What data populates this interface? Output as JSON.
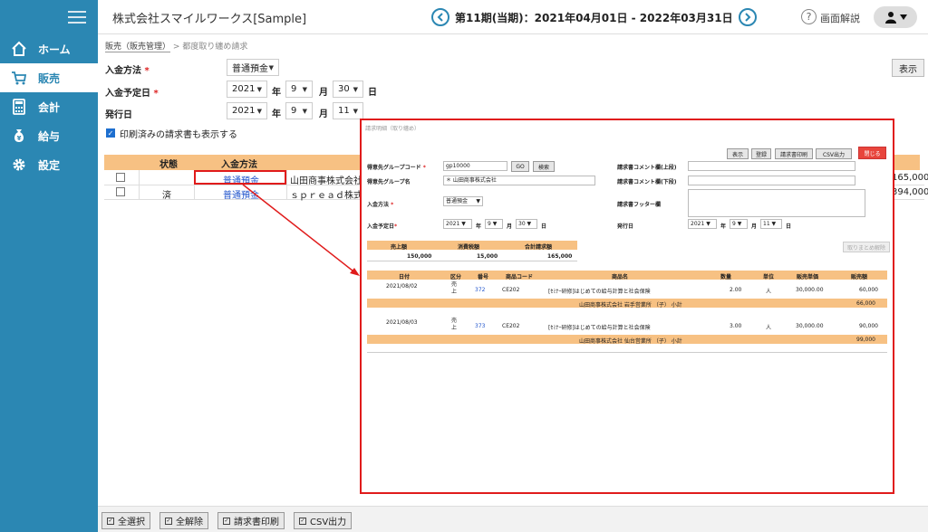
{
  "sidebar": {
    "items": [
      {
        "label": "ホーム",
        "icon": "home-icon"
      },
      {
        "label": "販売",
        "icon": "cart-icon"
      },
      {
        "label": "会計",
        "icon": "calculator-icon"
      },
      {
        "label": "給与",
        "icon": "money-bag-icon"
      },
      {
        "label": "設定",
        "icon": "gear-icon"
      }
    ]
  },
  "header": {
    "company": "株式会社スマイルワークス[Sample]",
    "period": "第11期(当期)：2021年04月01日 - 2022年03月31日",
    "help": "画面解説"
  },
  "breadcrumb": {
    "link": "販売（販売管理）",
    "sep": ">",
    "current": "都度取り纏め請求"
  },
  "form": {
    "payment_method_label": "入金方法",
    "payment_method_value": "普通預金",
    "due_date_label": "入金予定日",
    "due_year": "2021",
    "due_month": "9",
    "due_day": "30",
    "issue_date_label": "発行日",
    "issue_year": "2021",
    "issue_month": "9",
    "issue_day": "11",
    "year_unit": "年",
    "month_unit": "月",
    "day_unit": "日",
    "required": "*",
    "show_printed_label": "印刷済みの請求書も表示する",
    "show_button": "表示"
  },
  "list": {
    "headers": [
      "状態",
      "入金方法"
    ],
    "rows": [
      {
        "status": "",
        "method": "普通預金",
        "customer": "山田商事株式会社",
        "amount": "165,000"
      },
      {
        "status": "済",
        "method": "普通預金",
        "customer": "ｓｐｒｅａｄ株式",
        "amount": "394,000"
      }
    ]
  },
  "bottom": {
    "buttons": [
      "全選択",
      "全解除",
      "請求書印刷",
      "CSV出力"
    ]
  },
  "modal": {
    "title": "請求明細（取り纏め）",
    "buttons": [
      "表示",
      "登録",
      "請求書印刷",
      "CSV出力"
    ],
    "close": "閉じる",
    "group_code_label": "得意先グループコード",
    "group_code_value": "gp10000",
    "go": "GO",
    "search": "検索",
    "group_name_label": "得意先グループ名",
    "group_name_value": "＊ 山田商事株式会社",
    "method_label": "入金方法",
    "method_value": "普通預金",
    "due_label": "入金予定日",
    "due_year": "2021",
    "due_month": "9",
    "due_day": "30",
    "comment_top_label": "請求書コメント欄(上段)",
    "comment_bottom_label": "請求書コメント欄(下段)",
    "footer_label": "請求書フッター欄",
    "issue_label": "発行日",
    "issue_year": "2021",
    "issue_month": "9",
    "issue_day": "11",
    "summary_headers": [
      "売上額",
      "消費税額",
      "合計請求額"
    ],
    "summary_values": [
      "150,000",
      "15,000",
      "165,000"
    ],
    "cancel_button": "取りまとめ解除",
    "detail_headers": [
      "日付",
      "区分",
      "番号",
      "商品コード",
      "商品名",
      "数量",
      "単位",
      "販売単価",
      "販売額"
    ],
    "details": [
      {
        "date": "2021/08/02",
        "type": "売上",
        "no": "372",
        "code": "CE202",
        "name": "[ｾﾐﾅｰ研修]はじめての給与計算と社会保険",
        "qty": "2.00",
        "unit": "人",
        "price": "30,000.00",
        "amount": "60,000",
        "subtotal_label": "山田商事株式会社 岩手営業所 （子） 小計",
        "subtotal": "66,000"
      },
      {
        "date": "2021/08/03",
        "type": "売上",
        "no": "373",
        "code": "CE202",
        "name": "[ｾﾐﾅｰ研修]はじめての給与計算と社会保険",
        "qty": "3.00",
        "unit": "人",
        "price": "30,000.00",
        "amount": "90,000",
        "subtotal_label": "山田商事株式会社 仙台営業所 （子） 小計",
        "subtotal": "99,000"
      }
    ]
  }
}
